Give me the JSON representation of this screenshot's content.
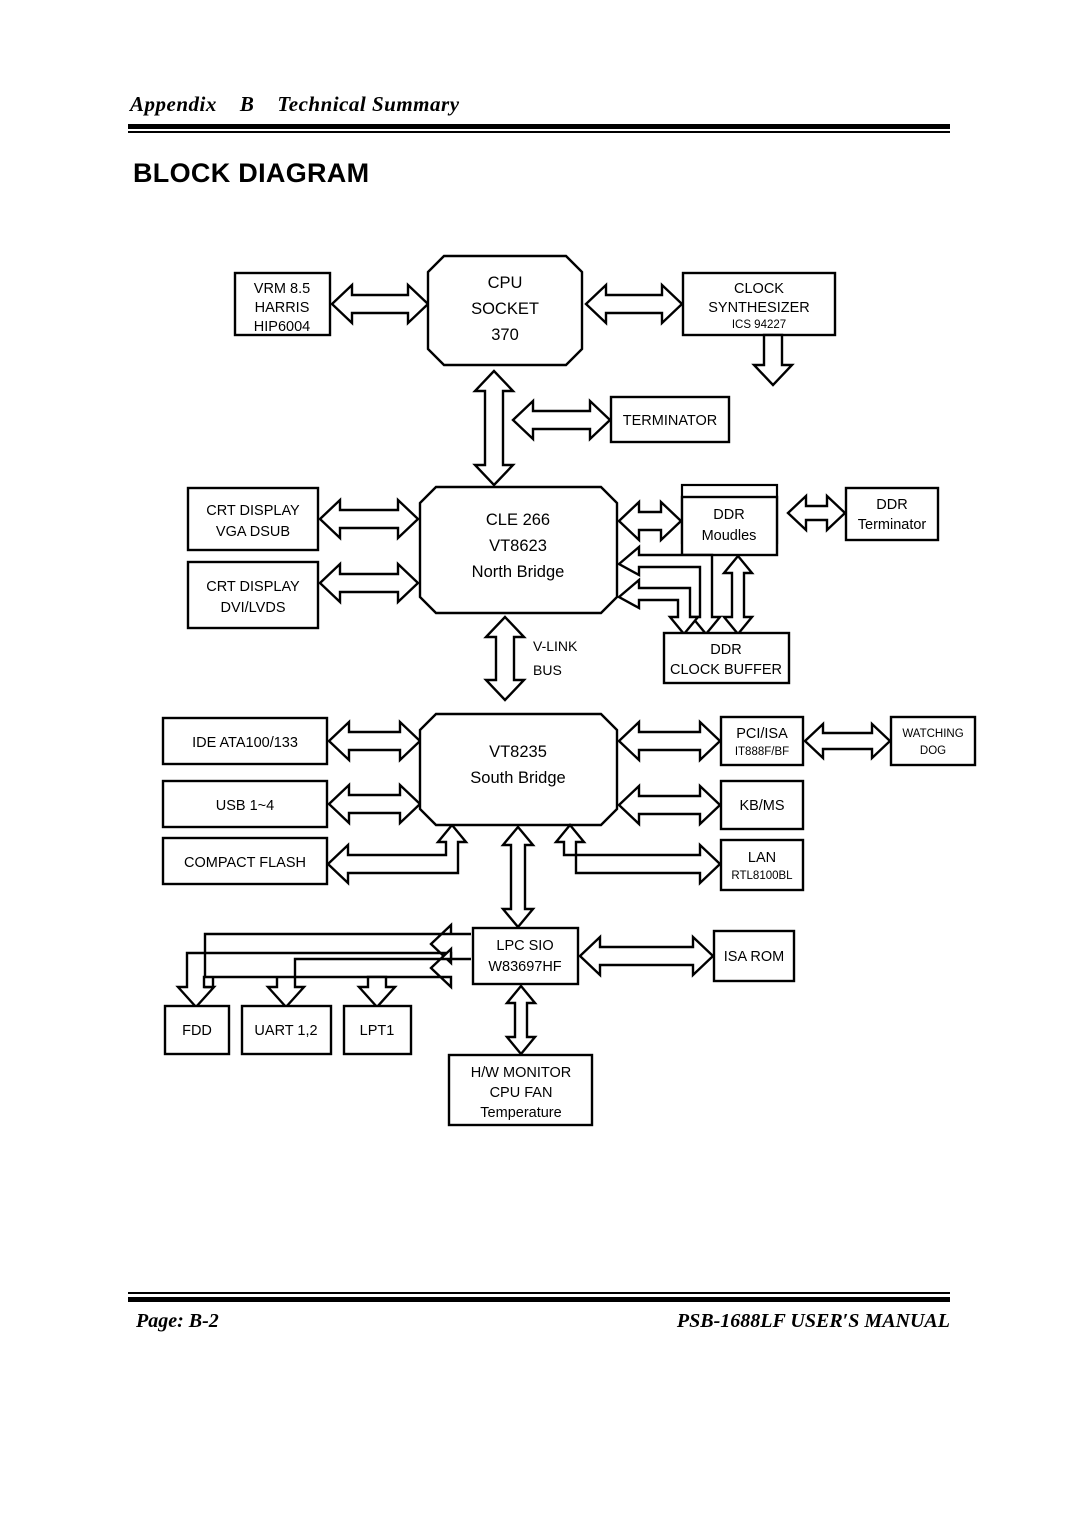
{
  "header": {
    "breadcrumb": "Appendix    B    Technical Summary",
    "section_title": "BLOCK DIAGRAM"
  },
  "footer": {
    "page_label": "Page: B-2",
    "manual_label": "PSB-1688LF USER′S MANUAL"
  },
  "diagram": {
    "title": "BLOCK DIAGRAM",
    "blocks": {
      "vrm": {
        "line1": "VRM 8.5",
        "line2": "HARRIS",
        "line3": "HIP6004"
      },
      "cpu": {
        "line1": "CPU",
        "line2": "SOCKET",
        "line3": "370"
      },
      "clock": {
        "line1": "CLOCK",
        "line2": "SYNTHESIZER",
        "line3": "ICS 94227"
      },
      "terminator": {
        "line1": "TERMINATOR"
      },
      "crt_vga": {
        "line1": "CRT DISPLAY",
        "line2": "VGA DSUB"
      },
      "crt_dvi": {
        "line1": "CRT DISPLAY",
        "line2": "DVI/LVDS"
      },
      "north_bridge": {
        "line1": "CLE 266",
        "line2": "VT8623",
        "line3": "North Bridge"
      },
      "ddr_modules": {
        "line1": "DDR",
        "line2": "Moudles"
      },
      "ddr_terminator": {
        "line1": "DDR",
        "line2": "Terminator"
      },
      "ddr_clock_buffer": {
        "line1": "DDR",
        "line2": "CLOCK BUFFER"
      },
      "vlink": {
        "line1": "V-LINK",
        "line2": "BUS"
      },
      "ide": {
        "line1": "IDE ATA100/133"
      },
      "usb": {
        "line1": "USB 1~4"
      },
      "compact_flash": {
        "line1": "COMPACT FLASH"
      },
      "south_bridge": {
        "line1": "VT8235",
        "line2": "South  Bridge"
      },
      "pci_isa": {
        "line1": "PCI/ISA",
        "line2": "IT888F/BF"
      },
      "watching_dog": {
        "line1": "WATCHING",
        "line2": "DOG"
      },
      "kb_ms": {
        "line1": "KB/MS"
      },
      "lan": {
        "line1": "LAN",
        "line2": "RTL8100BL"
      },
      "lpc_sio": {
        "line1": "LPC SIO",
        "line2": "W83697HF"
      },
      "isa_rom": {
        "line1": "ISA ROM"
      },
      "fdd": {
        "line1": "FDD"
      },
      "uart": {
        "line1": "UART 1,2"
      },
      "lpt1": {
        "line1": "LPT1"
      },
      "hw_monitor": {
        "line1": "H/W MONITOR",
        "line2": "CPU FAN",
        "line3": "Temperature"
      }
    },
    "colors": {
      "stroke": "#000000",
      "fill": "#ffffff"
    }
  }
}
